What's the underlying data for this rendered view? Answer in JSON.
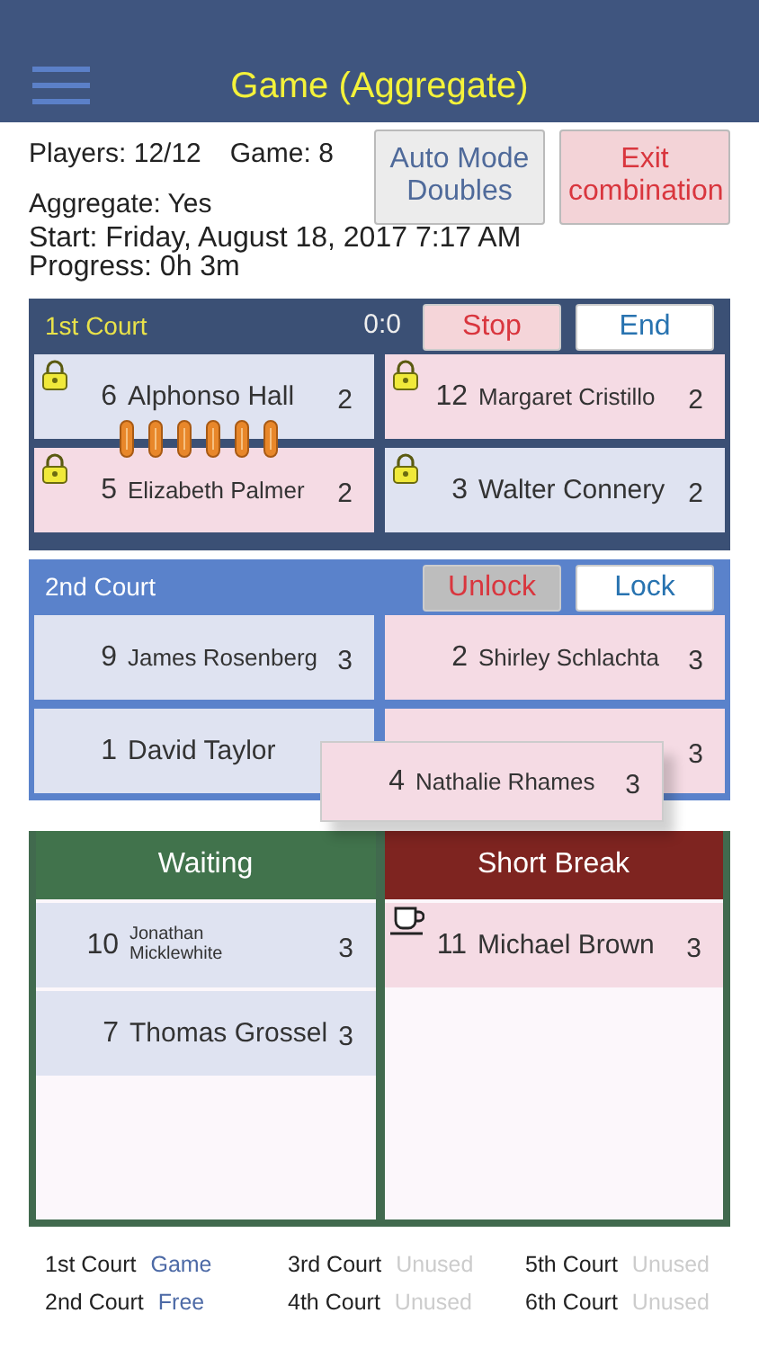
{
  "header": {
    "title": "Game (Aggregate)"
  },
  "info": {
    "players": "Players: 12/12",
    "game": "Game: 8",
    "aggregate": "Aggregate: Yes",
    "start": "Start: Friday, August 18, 2017 7:17 AM",
    "progress": "Progress: 0h 3m"
  },
  "top_buttons": [
    {
      "kind": "mode",
      "lines": [
        "Auto Mode",
        "Doubles"
      ]
    },
    {
      "kind": "exit",
      "lines": [
        "Exit",
        "combination"
      ]
    }
  ],
  "courts": [
    {
      "name": "1st Court",
      "kind": "game",
      "score": "0:0",
      "pair_link": true,
      "buttons": [
        {
          "label": "Stop",
          "kind": "stop"
        },
        {
          "label": "End",
          "kind": "end"
        }
      ],
      "players": [
        {
          "number": "6",
          "name": "Alphonso Hall",
          "score": "2",
          "color": "#dfe3f1",
          "locked": true
        },
        {
          "number": "12",
          "name": "Margaret Cristillo",
          "score": "2",
          "color": "#f5dbe4",
          "locked": true
        },
        {
          "number": "5",
          "name": "Elizabeth Palmer",
          "score": "2",
          "color": "#f5dbe4",
          "locked": true
        },
        {
          "number": "3",
          "name": "Walter Connery",
          "score": "2",
          "color": "#dfe3f1",
          "locked": true
        }
      ]
    },
    {
      "name": "2nd Court",
      "kind": "free",
      "pair_link": false,
      "buttons": [
        {
          "label": "Unlock",
          "kind": "unlock"
        },
        {
          "label": "Lock",
          "kind": "lock"
        }
      ],
      "players": [
        {
          "number": "9",
          "name": "James Rosenberg",
          "score": "3",
          "color": "#dfe3f1",
          "locked": false
        },
        {
          "number": "2",
          "name": "Shirley Schlachta",
          "score": "3",
          "color": "#f5dbe4",
          "locked": false
        },
        {
          "number": "1",
          "name": "David Taylor",
          "color": "#dfe3f1",
          "locked": false
        },
        {
          "score": "3",
          "color": "#f5dbe4",
          "locked": false
        }
      ]
    }
  ],
  "dragged_player": {
    "number": "4",
    "name": "Nathalie Rhames",
    "score": "3",
    "color": "#f5dbe4"
  },
  "lists": [
    {
      "title": "Waiting",
      "kind": "waiting",
      "players": [
        {
          "number": "10",
          "name": "Jonathan Micklewhite",
          "score": "3",
          "color": "#dfe3f1",
          "on_break": false
        },
        {
          "number": "7",
          "name": "Thomas Grossel",
          "score": "3",
          "color": "#dfe3f1",
          "on_break": false
        }
      ]
    },
    {
      "title": "Short Break",
      "kind": "break",
      "players": [
        {
          "number": "11",
          "name": "Michael Brown",
          "score": "3",
          "color": "#f5dbe4",
          "on_break": true
        }
      ]
    }
  ],
  "court_status": [
    {
      "court": "1st Court",
      "status": "Game",
      "kind": "game"
    },
    {
      "court": "2nd Court",
      "status": "Free",
      "kind": "free"
    },
    {
      "court": "3rd Court",
      "status": "Unused",
      "kind": "unused"
    },
    {
      "court": "4th Court",
      "status": "Unused",
      "kind": "unused"
    },
    {
      "court": "5th Court",
      "status": "Unused",
      "kind": "unused"
    },
    {
      "court": "6th Court",
      "status": "Unused",
      "kind": "unused"
    }
  ]
}
